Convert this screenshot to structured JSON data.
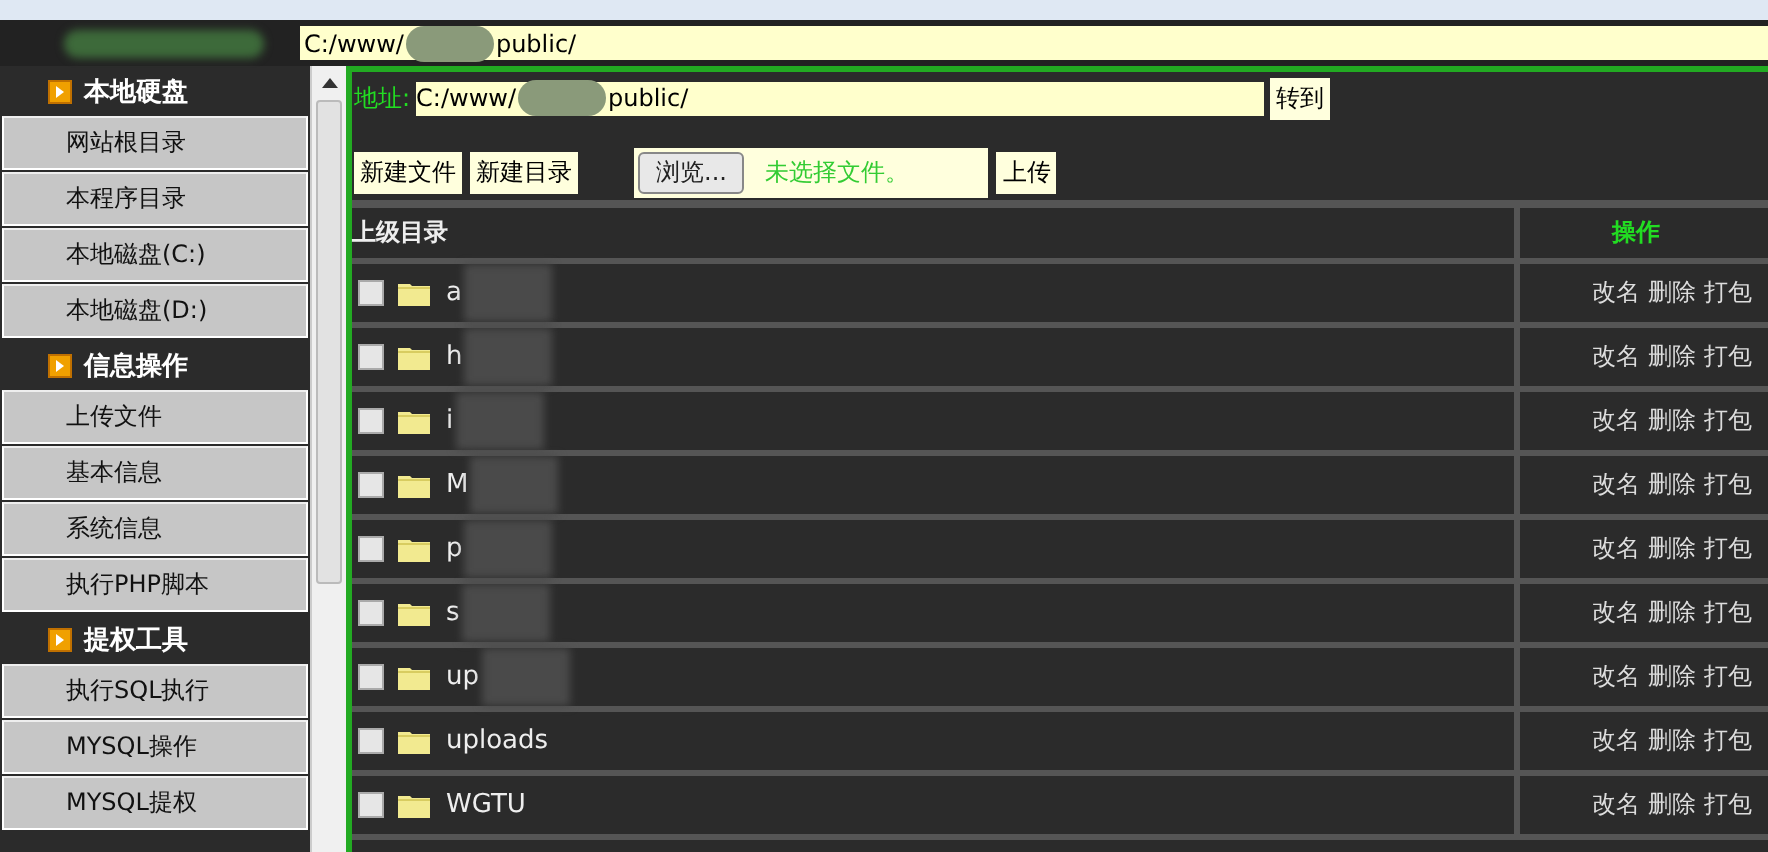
{
  "top_path": {
    "start": "C:/www/",
    "end": "public/"
  },
  "sidebar": [
    {
      "title": "本地硬盘",
      "items": [
        "网站根目录",
        "本程序目录",
        "本地磁盘(C:)",
        "本地磁盘(D:)"
      ]
    },
    {
      "title": "信息操作",
      "items": [
        "上传文件",
        "基本信息",
        "系统信息",
        "执行PHP脚本"
      ]
    },
    {
      "title": "提权工具",
      "items": [
        "执行SQL执行",
        "MYSQL操作",
        "MYSQL提权"
      ]
    }
  ],
  "address": {
    "label": "地址:",
    "start": "C:/www/",
    "end": "public/",
    "go": "转到"
  },
  "toolbar": {
    "new_file": "新建文件",
    "new_dir": "新建目录",
    "browse": "浏览...",
    "no_file": "未选择文件。",
    "upload": "上传"
  },
  "table": {
    "parent": "上级目录",
    "actions_header": "操作",
    "rows": [
      {
        "name": "a",
        "blurred": true,
        "checked": false,
        "actions": [
          "改名",
          "删除",
          "打包"
        ]
      },
      {
        "name": "h",
        "blurred": true,
        "checked": false,
        "actions": [
          "改名",
          "删除",
          "打包"
        ]
      },
      {
        "name": "i",
        "blurred": true,
        "checked": false,
        "actions": [
          "改名",
          "删除",
          "打包"
        ]
      },
      {
        "name": "M",
        "blurred": true,
        "checked": false,
        "actions": [
          "改名",
          "删除",
          "打包"
        ]
      },
      {
        "name": "p",
        "blurred": true,
        "checked": false,
        "actions": [
          "改名",
          "删除",
          "打包"
        ]
      },
      {
        "name": "s",
        "blurred": true,
        "checked": false,
        "actions": [
          "改名",
          "删除",
          "打包"
        ]
      },
      {
        "name": "up",
        "blurred": true,
        "checked": false,
        "actions": [
          "改名",
          "删除",
          "打包"
        ]
      },
      {
        "name": "uploads",
        "blurred": false,
        "checked": false,
        "actions": [
          "改名",
          "删除",
          "打包"
        ]
      },
      {
        "name": "WGTU",
        "blurred": false,
        "checked": false,
        "actions": [
          "改名",
          "删除",
          "打包"
        ]
      }
    ]
  }
}
